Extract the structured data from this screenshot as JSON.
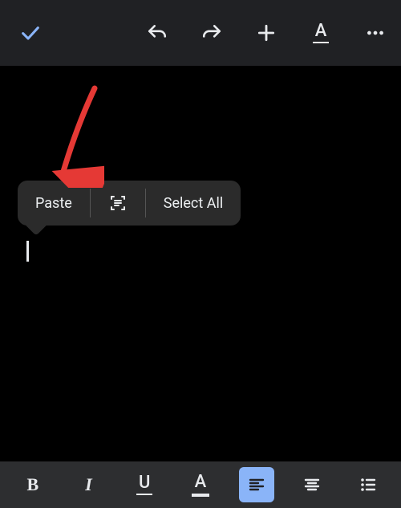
{
  "context_menu": {
    "paste_label": "Paste",
    "select_all_label": "Select All"
  }
}
